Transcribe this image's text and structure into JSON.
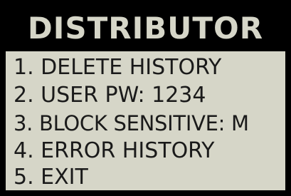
{
  "screen": {
    "title": "DISTRIBUTOR",
    "menu": [
      "1. DELETE HISTORY",
      "2. USER PW: 1234",
      "3. BLOCK SENSITIVE: M",
      "4. ERROR HISTORY",
      "5. EXIT"
    ]
  },
  "colors": {
    "lcd_background": "#d6d6c8",
    "title_bar": "#000000",
    "text": "#1a1a1a",
    "bezel": "#000000"
  }
}
